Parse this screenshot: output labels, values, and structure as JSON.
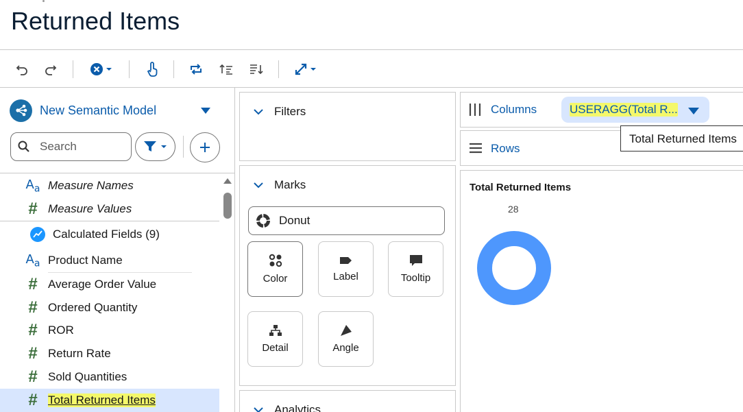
{
  "page": {
    "title": "Returned Items"
  },
  "toolbar": {
    "undo_icon": "undo-icon",
    "redo_icon": "redo-icon",
    "clear_icon": "clear-icon",
    "touch_icon": "touch-icon",
    "swap_icon": "swap-icon",
    "sort_asc_icon": "sort-ascending-icon",
    "sort_desc_icon": "sort-descending-icon",
    "fit_icon": "expand-icon"
  },
  "left": {
    "model_name": "New Semantic Model",
    "search_placeholder": "Search",
    "fields": [
      {
        "label": "Measure Names",
        "type": "text",
        "italic": true
      },
      {
        "label": "Measure Values",
        "type": "number",
        "italic": true
      },
      {
        "label": "Calculated Fields (9)",
        "type": "calc"
      },
      {
        "label": "Product Name",
        "type": "text"
      },
      {
        "label": "Average Order Value",
        "type": "number"
      },
      {
        "label": "Ordered Quantity",
        "type": "number"
      },
      {
        "label": "ROR",
        "type": "number"
      },
      {
        "label": "Return Rate",
        "type": "number"
      },
      {
        "label": "Sold Quantities",
        "type": "number"
      },
      {
        "label": "Total Returned Items",
        "type": "number",
        "selected": true
      }
    ]
  },
  "middle": {
    "filters_label": "Filters",
    "marks_label": "Marks",
    "mark_type": "Donut",
    "mark_buttons": [
      "Color",
      "Label",
      "Tooltip",
      "Detail",
      "Angle"
    ],
    "analytics_label": "Analytics"
  },
  "shelves": {
    "columns_label": "Columns",
    "columns_pill": "USERAGG(Total R...",
    "rows_label": "Rows",
    "tooltip": "Total Returned Items"
  },
  "viz": {
    "title": "Total Returned Items",
    "value_label": "28",
    "donut_color": "#4e97fd"
  },
  "colors": {
    "accent": "#0b5cab",
    "highlight": "#f4f86b",
    "selected": "#d8e6fe"
  }
}
